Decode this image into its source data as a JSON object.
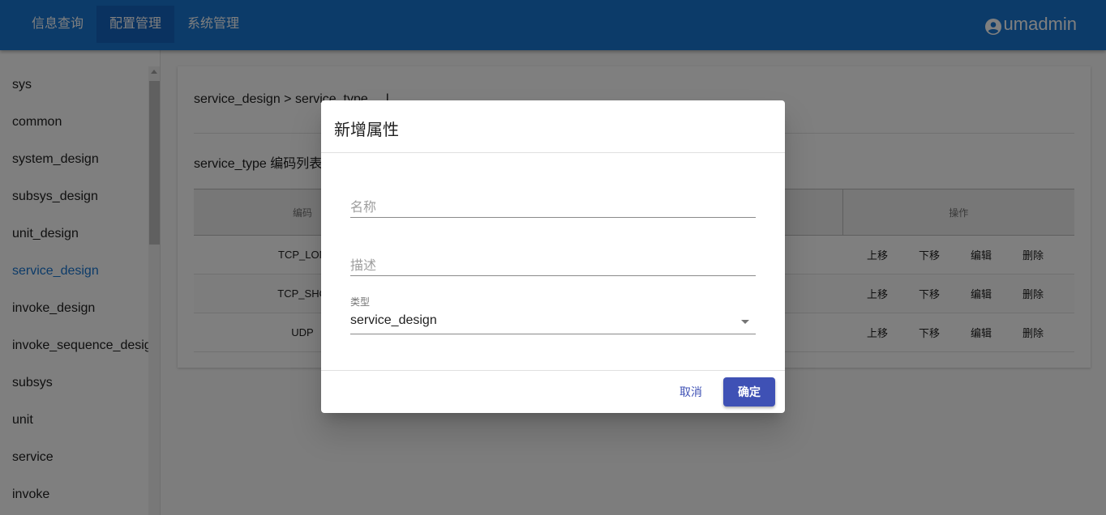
{
  "topnav": {
    "items": [
      {
        "label": "信息查询"
      },
      {
        "label": "配置管理"
      },
      {
        "label": "系统管理"
      }
    ],
    "user": "umadmin"
  },
  "sidebar": {
    "items": [
      {
        "label": "sys"
      },
      {
        "label": "common"
      },
      {
        "label": "system_design"
      },
      {
        "label": "subsys_design"
      },
      {
        "label": "unit_design"
      },
      {
        "label": "service_design"
      },
      {
        "label": "invoke_design"
      },
      {
        "label": "invoke_sequence_design"
      },
      {
        "label": "subsys"
      },
      {
        "label": "unit"
      },
      {
        "label": "service"
      },
      {
        "label": "invoke"
      }
    ],
    "active": "service_design"
  },
  "content": {
    "breadcrumb": "service_design > service_type ... l",
    "list_title": "service_type 编码列表",
    "table": {
      "headers": {
        "code": "编码",
        "op": "操作"
      },
      "rows": [
        {
          "code": "TCP_LON"
        },
        {
          "code": "TCP_SHO"
        },
        {
          "code": "UDP"
        }
      ],
      "actions": [
        "上移",
        "下移",
        "编辑",
        "删除"
      ]
    }
  },
  "dialog": {
    "title": "新增属性",
    "name_placeholder": "名称",
    "desc_placeholder": "描述",
    "type_label": "类型",
    "type_value": "service_design",
    "cancel": "取消",
    "ok": "确定"
  },
  "colors": {
    "primary": "#1976d2",
    "accent": "#3f51b5"
  }
}
